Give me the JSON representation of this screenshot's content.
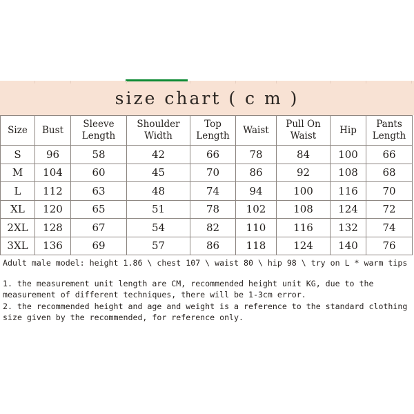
{
  "title": {
    "text": "size chart ( c m )",
    "accent_color": "#0d8a34",
    "band_color": "#f8e2d4"
  },
  "table": {
    "columns": [
      "Size",
      "Bust",
      "Sleeve Length",
      "Shoulder Width",
      "Top Length",
      "Waist",
      "Pull On Waist",
      "Hip",
      "Pants Length"
    ],
    "rows": [
      {
        "size": "S",
        "bust": "96",
        "sleeve_length": "58",
        "shoulder_width": "42",
        "top_length": "66",
        "waist": "78",
        "pull_on_waist": "84",
        "hip": "100",
        "pants_length": "66"
      },
      {
        "size": "M",
        "bust": "104",
        "sleeve_length": "60",
        "shoulder_width": "45",
        "top_length": "70",
        "waist": "86",
        "pull_on_waist": "92",
        "hip": "108",
        "pants_length": "68"
      },
      {
        "size": "L",
        "bust": "112",
        "sleeve_length": "63",
        "shoulder_width": "48",
        "top_length": "74",
        "waist": "94",
        "pull_on_waist": "100",
        "hip": "116",
        "pants_length": "70"
      },
      {
        "size": "XL",
        "bust": "120",
        "sleeve_length": "65",
        "shoulder_width": "51",
        "top_length": "78",
        "waist": "102",
        "pull_on_waist": "108",
        "hip": "124",
        "pants_length": "72"
      },
      {
        "size": "2XL",
        "bust": "128",
        "sleeve_length": "67",
        "shoulder_width": "54",
        "top_length": "82",
        "waist": "110",
        "pull_on_waist": "116",
        "hip": "132",
        "pants_length": "74"
      },
      {
        "size": "3XL",
        "bust": "136",
        "sleeve_length": "69",
        "shoulder_width": "57",
        "top_length": "86",
        "waist": "118",
        "pull_on_waist": "124",
        "hip": "140",
        "pants_length": "76"
      }
    ]
  },
  "notes": {
    "model": "Adult male model: height 1.86 \\ chest 107 \\ waist 80 \\ hip 98 \\ try on L * warm tips",
    "items": [
      "1. the measurement unit length are CM, recommended height unit KG, due to the measurement of different techniques, there will be 1-3cm error.",
      "2. the recommended height and age and weight is a reference to the standard clothing size given by the recommended, for reference only."
    ]
  }
}
